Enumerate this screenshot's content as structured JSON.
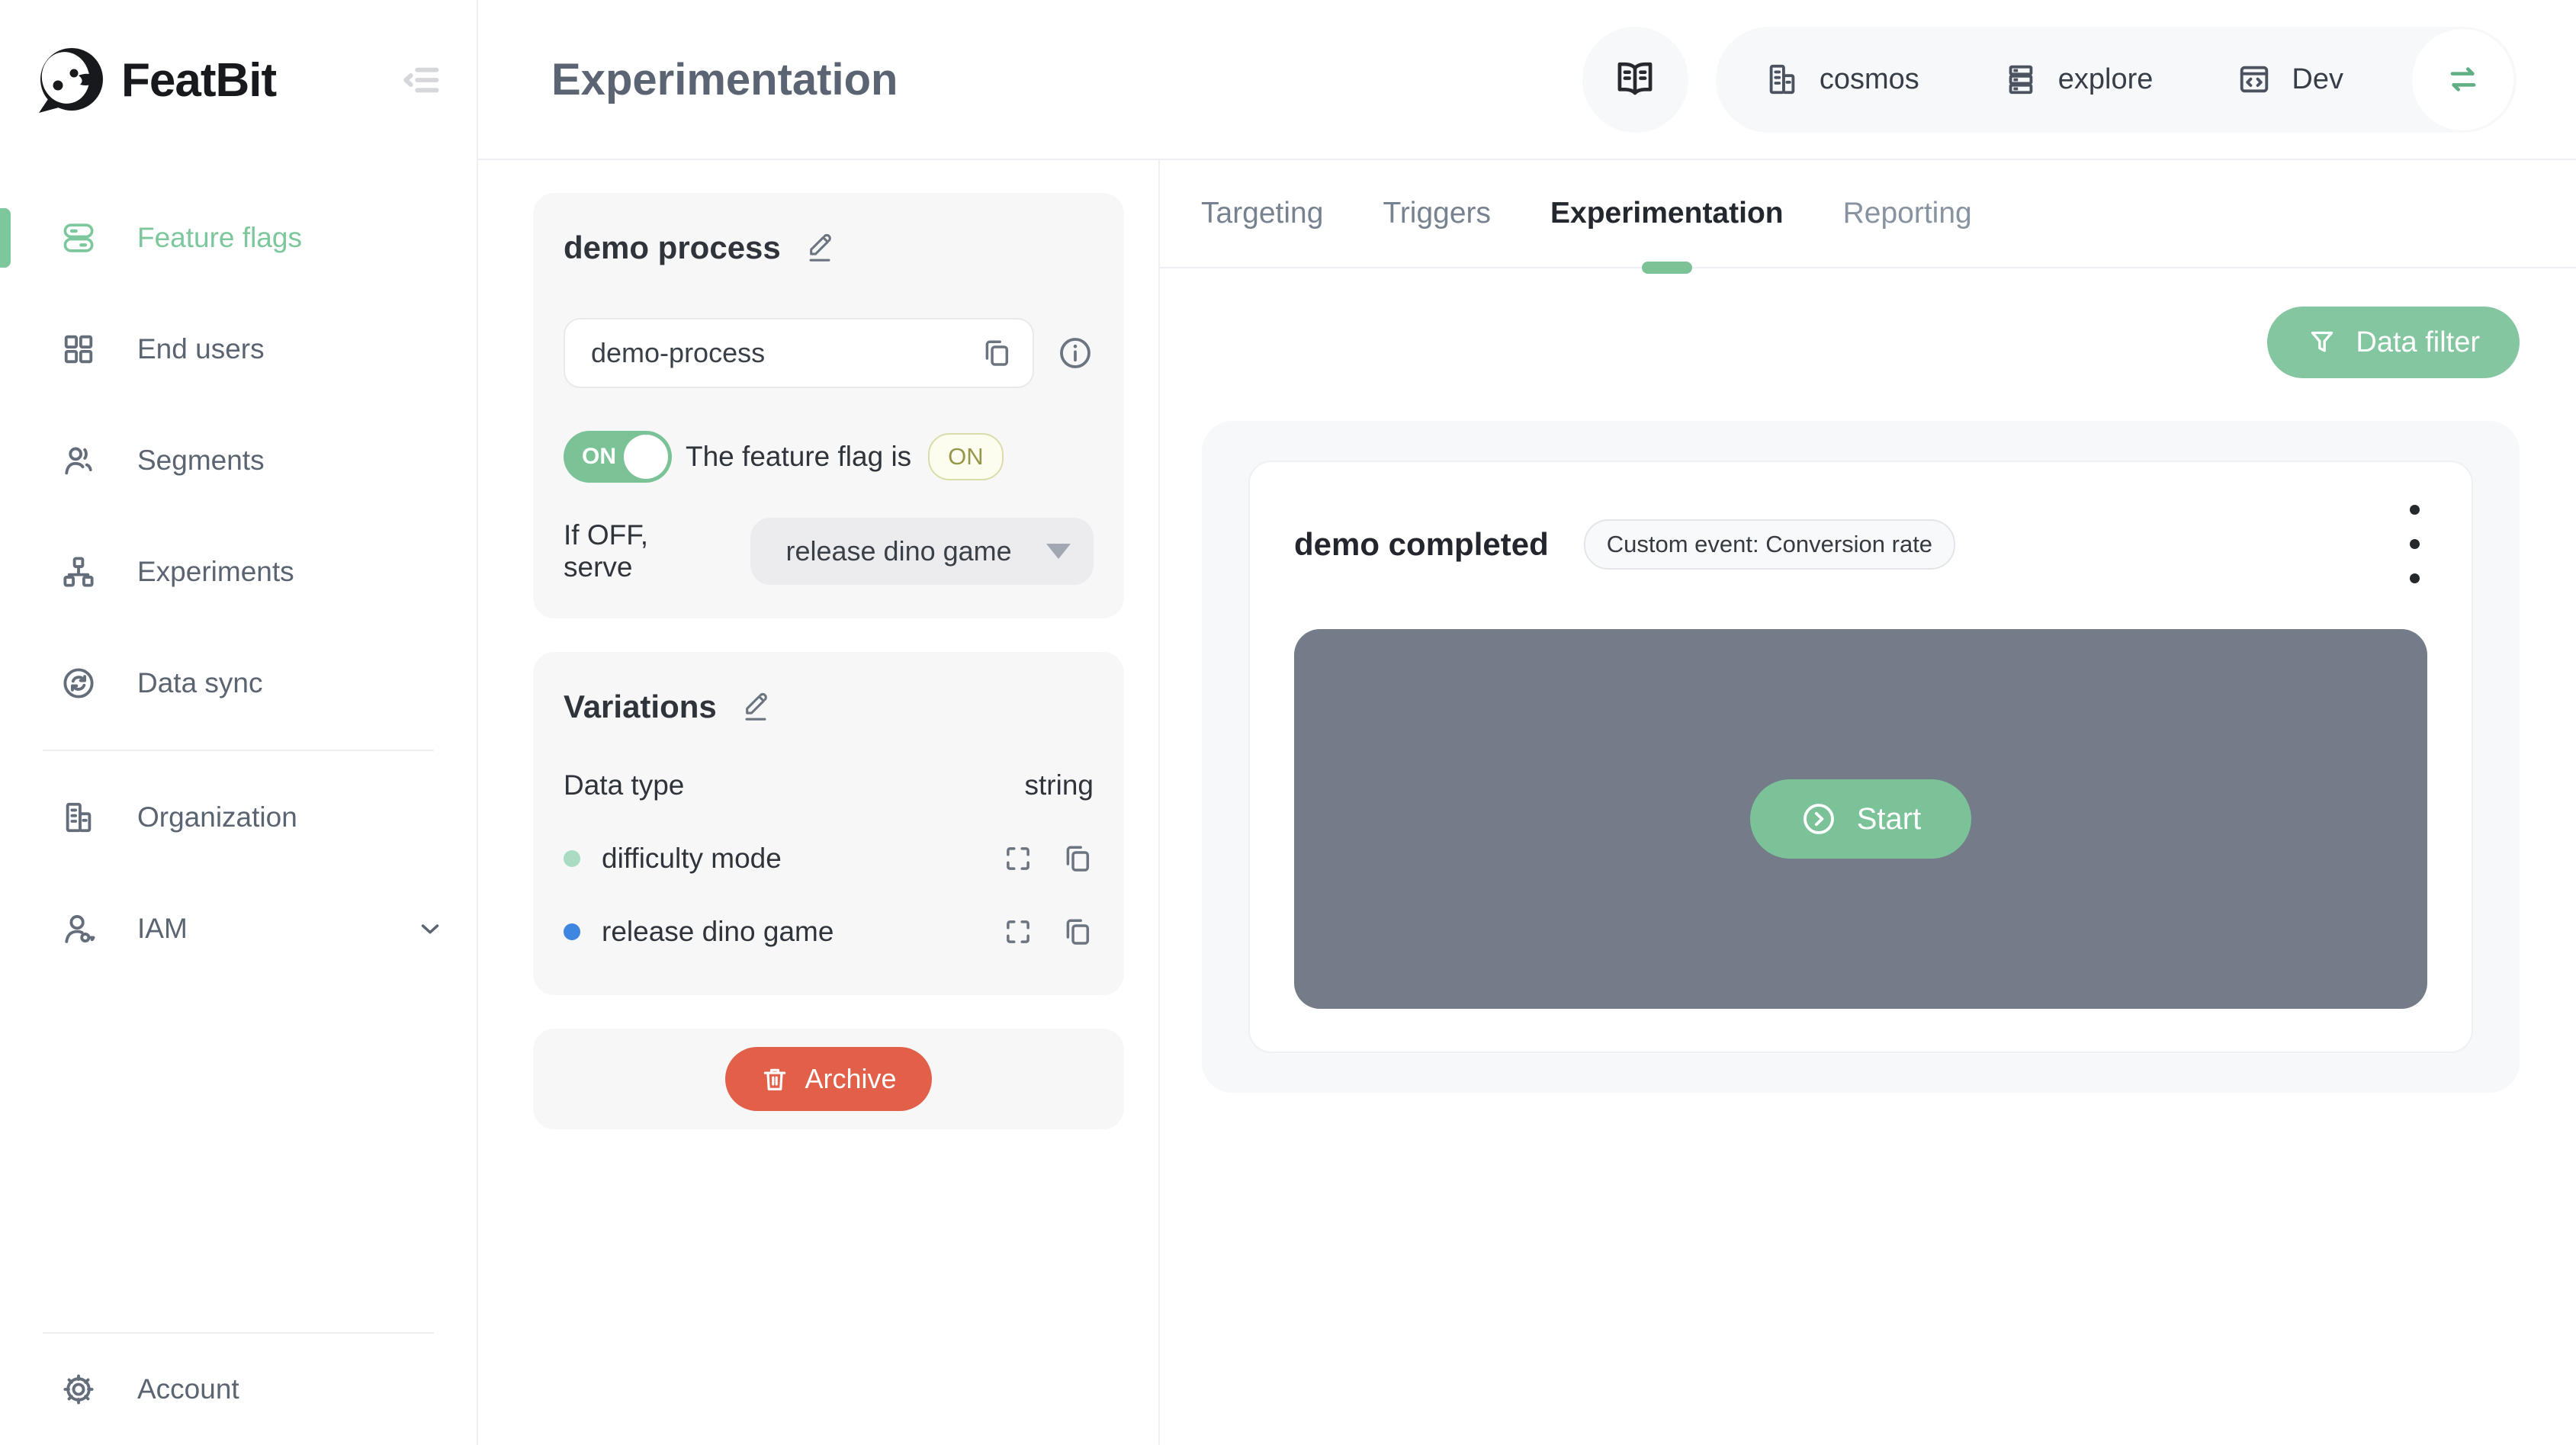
{
  "brand": {
    "name": "FeatBit"
  },
  "header": {
    "title": "Experimentation",
    "project": "cosmos",
    "workspace": "explore",
    "environment": "Dev"
  },
  "sidebar": {
    "items": [
      {
        "label": "Feature flags",
        "active": true
      },
      {
        "label": "End users",
        "active": false
      },
      {
        "label": "Segments",
        "active": false
      },
      {
        "label": "Experiments",
        "active": false
      },
      {
        "label": "Data sync",
        "active": false
      },
      {
        "label": "Organization",
        "active": false
      },
      {
        "label": "IAM",
        "active": false
      }
    ],
    "account_label": "Account"
  },
  "flag": {
    "name": "demo process",
    "key": "demo-process",
    "toggle_state": "ON",
    "status_prefix": "The feature flag is",
    "status_value": "ON",
    "off_serve_label": "If OFF, serve",
    "off_variation": "release dino game"
  },
  "variations": {
    "title": "Variations",
    "data_type_label": "Data type",
    "data_type_value": "string",
    "items": [
      {
        "name": "difficulty mode",
        "color": "#a9dcc1"
      },
      {
        "name": "release dino game",
        "color": "#3e86e0"
      }
    ]
  },
  "tabs": {
    "items": [
      {
        "label": "Targeting",
        "active": false
      },
      {
        "label": "Triggers",
        "active": false
      },
      {
        "label": "Experimentation",
        "active": true
      },
      {
        "label": "Reporting",
        "active": false
      }
    ]
  },
  "actions": {
    "archive": "Archive",
    "data_filter": "Data filter",
    "start": "Start"
  },
  "experiment": {
    "name": "demo completed",
    "event_badge": "Custom event: Conversion rate"
  },
  "colors": {
    "accent_green": "#7cc297",
    "archive_red": "#e2604a",
    "chart_placeholder": "#747c89",
    "status_badge_text": "#97974b"
  }
}
